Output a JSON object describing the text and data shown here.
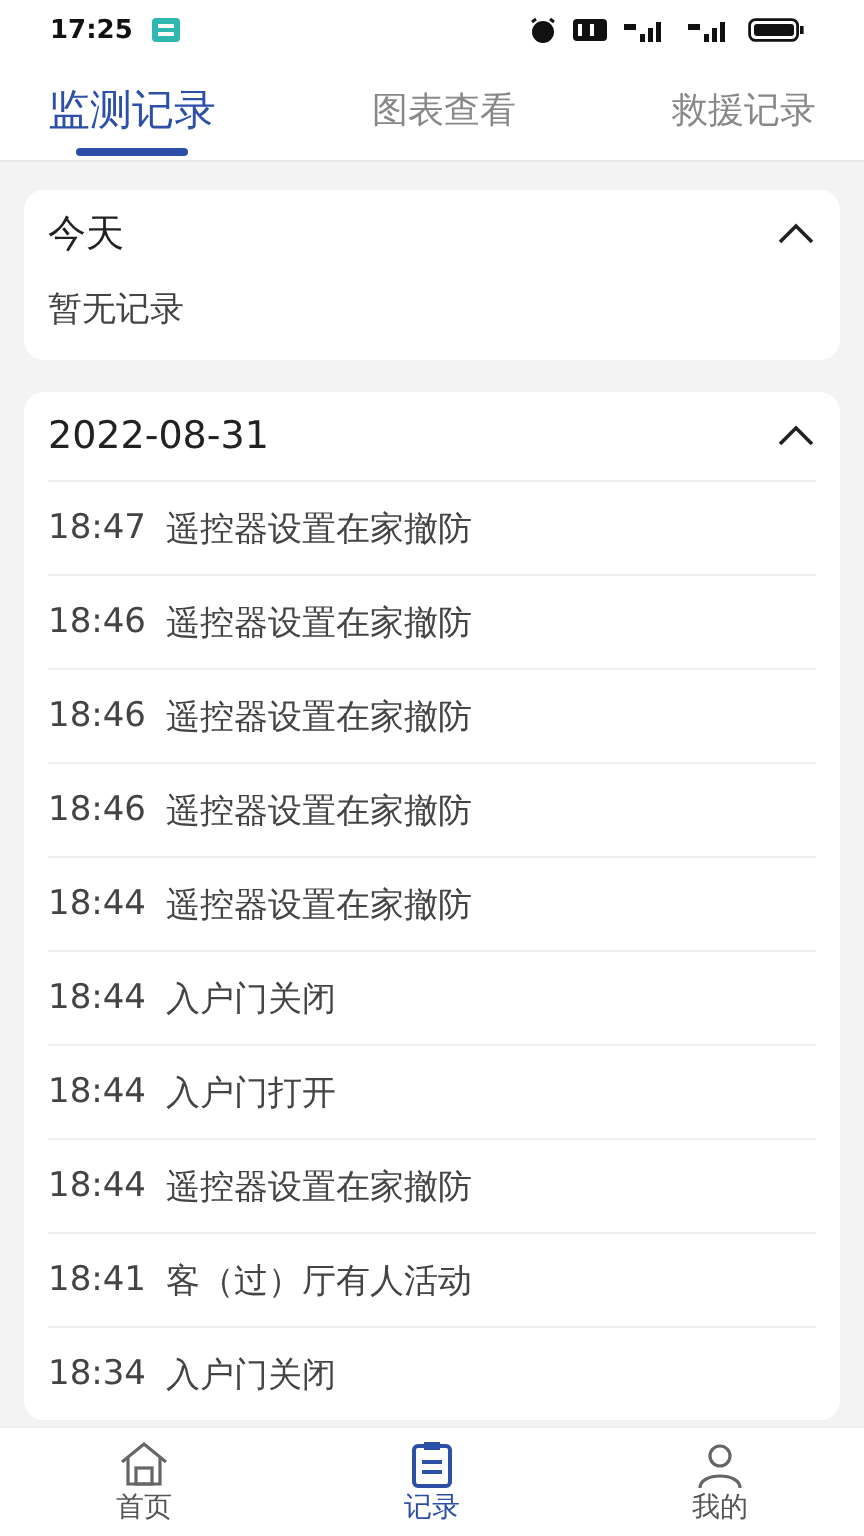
{
  "status_bar": {
    "time": "17:25"
  },
  "tabs": [
    {
      "label": "监测记录",
      "selected": true
    },
    {
      "label": "图表查看",
      "selected": false
    },
    {
      "label": "救援记录",
      "selected": false
    }
  ],
  "sections": [
    {
      "title": "今天",
      "expanded": true,
      "empty_text": "暂无记录"
    },
    {
      "title": "2022-08-31",
      "expanded": true,
      "records": [
        {
          "time": "18:47",
          "event": "遥控器设置在家撤防"
        },
        {
          "time": "18:46",
          "event": "遥控器设置在家撤防"
        },
        {
          "time": "18:46",
          "event": "遥控器设置在家撤防"
        },
        {
          "time": "18:46",
          "event": "遥控器设置在家撤防"
        },
        {
          "time": "18:44",
          "event": "遥控器设置在家撤防"
        },
        {
          "time": "18:44",
          "event": "入户门关闭"
        },
        {
          "time": "18:44",
          "event": "入户门打开"
        },
        {
          "time": "18:44",
          "event": "遥控器设置在家撤防"
        },
        {
          "time": "18:41",
          "event": "客（过）厅有人活动"
        },
        {
          "time": "18:34",
          "event": "入户门关闭"
        }
      ]
    }
  ],
  "bottom_nav": [
    {
      "kind": "home",
      "label": "首页",
      "selected": false
    },
    {
      "kind": "records",
      "label": "记录",
      "selected": true
    },
    {
      "kind": "profile",
      "label": "我的",
      "selected": false
    }
  ]
}
